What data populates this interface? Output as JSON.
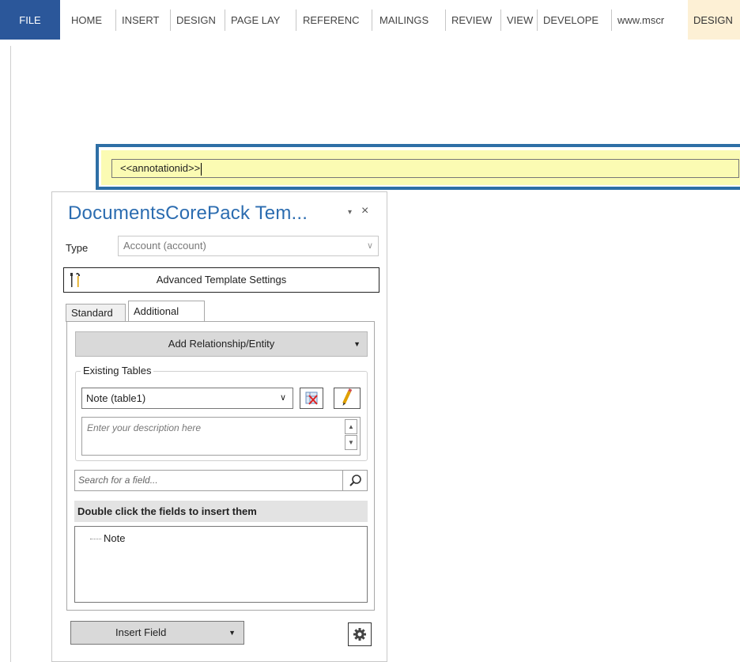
{
  "ribbon": {
    "tabs": [
      "FILE",
      "HOME",
      "INSERT",
      "DESIGN",
      "PAGE LAY",
      "REFERENC",
      "MAILINGS",
      "REVIEW",
      "VIEW",
      "DEVELOPE",
      "www.mscr",
      "DESIGN"
    ]
  },
  "document": {
    "field_text": "<<annotationid>>"
  },
  "pane": {
    "title": "DocumentsCorePack Tem...",
    "dropdown_glyph": "▾",
    "close_glyph": "×",
    "type_label": "Type",
    "type_value": "Account (account)",
    "advanced_settings_label": "Advanced Template Settings",
    "tab_standard": "Standard",
    "tab_additional": "Additional",
    "add_relationship_label": "Add Relationship/Entity",
    "existing_tables_label": "Existing Tables",
    "table_selected": "Note  (table1)",
    "description_placeholder": "Enter your description here",
    "search_placeholder": "Search for a field...",
    "fields_header": "Double click the fields to insert them",
    "fields": [
      "Note"
    ],
    "insert_field_label": "Insert Field"
  }
}
